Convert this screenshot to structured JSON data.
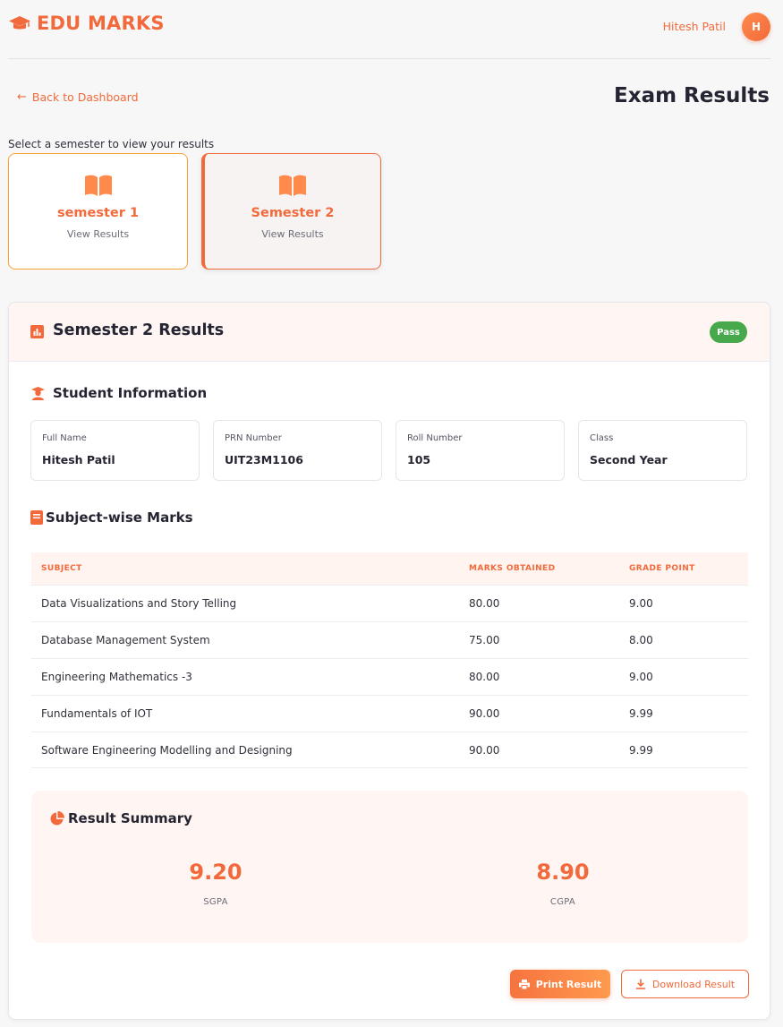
{
  "brand": {
    "name": "EDU MARKS",
    "icon": "graduation-cap-icon"
  },
  "user": {
    "name": "Hitesh Patil",
    "initial": "H"
  },
  "nav": {
    "back_label": "Back to Dashboard"
  },
  "page": {
    "title": "Exam Results",
    "select_hint": "Select a semester to view your results"
  },
  "semesters": [
    {
      "label": "semester 1",
      "sub": "View Results",
      "active": false
    },
    {
      "label": "Semester 2",
      "sub": "View Results",
      "active": true
    }
  ],
  "results": {
    "title": "Semester 2 Results",
    "status": "Pass",
    "student_section": "Student Information",
    "info": [
      {
        "label": "Full Name",
        "value": "Hitesh Patil"
      },
      {
        "label": "PRN Number",
        "value": "UIT23M1106"
      },
      {
        "label": "Roll Number",
        "value": "105"
      },
      {
        "label": "Class",
        "value": "Second Year"
      }
    ],
    "marks_section": "Subject-wise Marks",
    "table": {
      "headers": [
        "SUBJECT",
        "MARKS OBTAINED",
        "GRADE POINT"
      ],
      "rows": [
        [
          "Data Visualizations and Story Telling",
          "80.00",
          "9.00"
        ],
        [
          "Database Management System",
          "75.00",
          "8.00"
        ],
        [
          "Engineering Mathematics -3",
          "80.00",
          "9.00"
        ],
        [
          "Fundamentals of IOT",
          "90.00",
          "9.99"
        ],
        [
          "Software Engineering Modelling and Designing",
          "90.00",
          "9.99"
        ]
      ]
    },
    "summary": {
      "title": "Result Summary",
      "sgpa": {
        "value": "9.20",
        "label": "SGPA"
      },
      "cgpa": {
        "value": "8.90",
        "label": "CGPA"
      }
    },
    "actions": {
      "print": "Print Result",
      "download": "Download Result"
    }
  },
  "colors": {
    "accent": "#f26a3b",
    "pass": "#48a84c",
    "card_border": "#f6a336"
  }
}
